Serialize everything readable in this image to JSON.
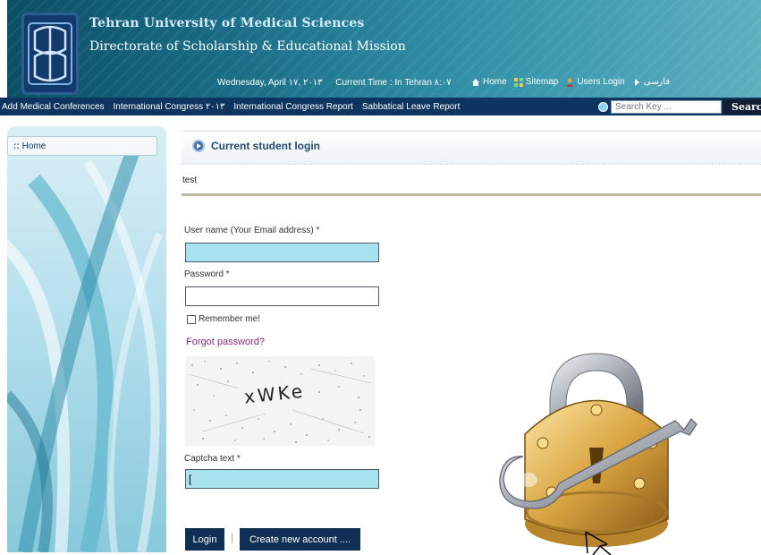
{
  "header": {
    "title1": "Tehran University of Medical Sciences",
    "title2": "Directorate of Scholarship & Educational Mission",
    "date": "Wednesday, April ۱۷, ۲۰۱۳",
    "time": "Current Time : In Tehran ۸:۰۷",
    "links": {
      "home": "Home",
      "sitemap": "Sitemap",
      "users_login": "Users Login",
      "farsi": "فارسی"
    }
  },
  "nav": {
    "items": [
      "Add Medical Conferences",
      "International Congress ۲۰۱۳",
      "International Congress Report",
      "Sabbatical Leave Report"
    ],
    "search_placeholder": "Search Key ...",
    "search_button": "Search"
  },
  "sidebar": {
    "home": "Home"
  },
  "main": {
    "title": "Current student login",
    "subtext": "test",
    "username_label": "User name (Your Email address) *",
    "password_label": "Password *",
    "remember_label": "Remember me!",
    "forgot_label": "Forgot password?",
    "captcha_image_text": "xWKe",
    "captcha_label": "Captcha text *",
    "captcha_value": "[",
    "login_button": "Login",
    "separator": "|",
    "create_button": "Create new account ...."
  },
  "colors": {
    "nav_bg": "#0e3560",
    "field_highlight": "#a7e2ee",
    "link_purple": "#8a2a78"
  }
}
